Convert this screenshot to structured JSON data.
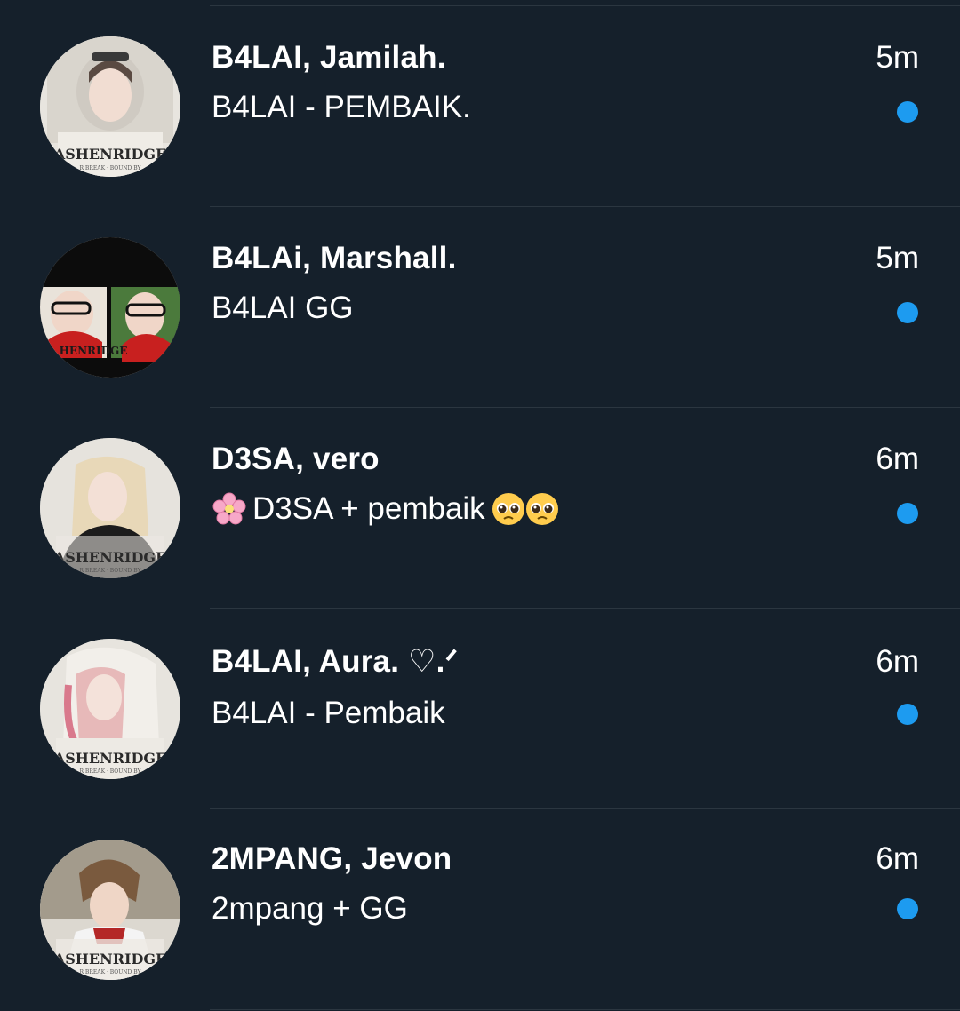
{
  "conversations": [
    {
      "name": "B4LAI, Jamilah.",
      "preview": "B4LAI - PEMBAIK.",
      "time": "5m",
      "unread": true,
      "avatar_icon": "profile-photo-icon",
      "avatar_caption": "ASHENRIDGE"
    },
    {
      "name": "B4LAi, Marshall.",
      "preview": "B4LAI GG",
      "time": "5m",
      "unread": true,
      "avatar_icon": "profile-photo-icon",
      "avatar_caption": "ASHENRIDGE"
    },
    {
      "name": "D3SA, vero",
      "preview_prefix_emoji": "cherry-blossom-icon",
      "preview": "D3SA + pembaik",
      "preview_suffix_emoji": [
        "pleading-face-icon",
        "pleading-face-icon"
      ],
      "time": "6m",
      "unread": true,
      "avatar_icon": "profile-photo-icon",
      "avatar_caption": "ASHENRIDGE"
    },
    {
      "name": "B4LAI, Aura. ♡.ᐟ",
      "preview": "B4LAI - Pembaik",
      "time": "6m",
      "unread": true,
      "avatar_icon": "profile-photo-icon",
      "avatar_caption": "ASHENRIDGE"
    },
    {
      "name": "2MPANG, Jevon",
      "preview": "2mpang + GG",
      "time": "6m",
      "unread": true,
      "avatar_icon": "profile-photo-icon",
      "avatar_caption": "ASHENRIDGE"
    }
  ],
  "colors": {
    "background": "#15202b",
    "divider": "#2b3640",
    "unread_dot": "#1d9bf0",
    "text": "#ffffff"
  }
}
